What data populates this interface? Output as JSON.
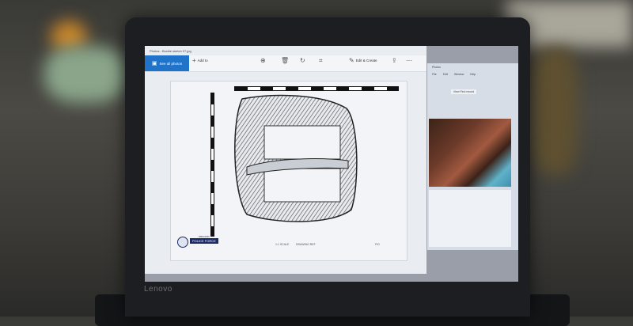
{
  "laptop": {
    "brand": "Lenovo"
  },
  "photos_app": {
    "window_title": "Photos - Buckle sketch 07.jpg",
    "see_all_label": "See all photos",
    "add_to_label": "Add to",
    "toolbar_icons": [
      "zoom-icon",
      "delete-icon",
      "rotate-icon",
      "crop-icon"
    ],
    "edit_create_label": "Edit & Create",
    "icons": {
      "share": "share-icon",
      "print": "print-icon",
      "more": "more-icon"
    }
  },
  "drawing": {
    "subject": "buckle",
    "badge_text": "POLICE FORCE",
    "badge_top_text": "MIDLAND",
    "caption_left": "1:1 SCALE",
    "caption_mid": "DRAWING REF",
    "caption_right": "FIG"
  },
  "side_window": {
    "title": "Photos",
    "menu_items": [
      "File",
      "Edit",
      "Window",
      "Help"
    ],
    "tab_label": "View Find record"
  },
  "colors": {
    "accent": "#1f73c9",
    "badge": "#1c2b63"
  }
}
